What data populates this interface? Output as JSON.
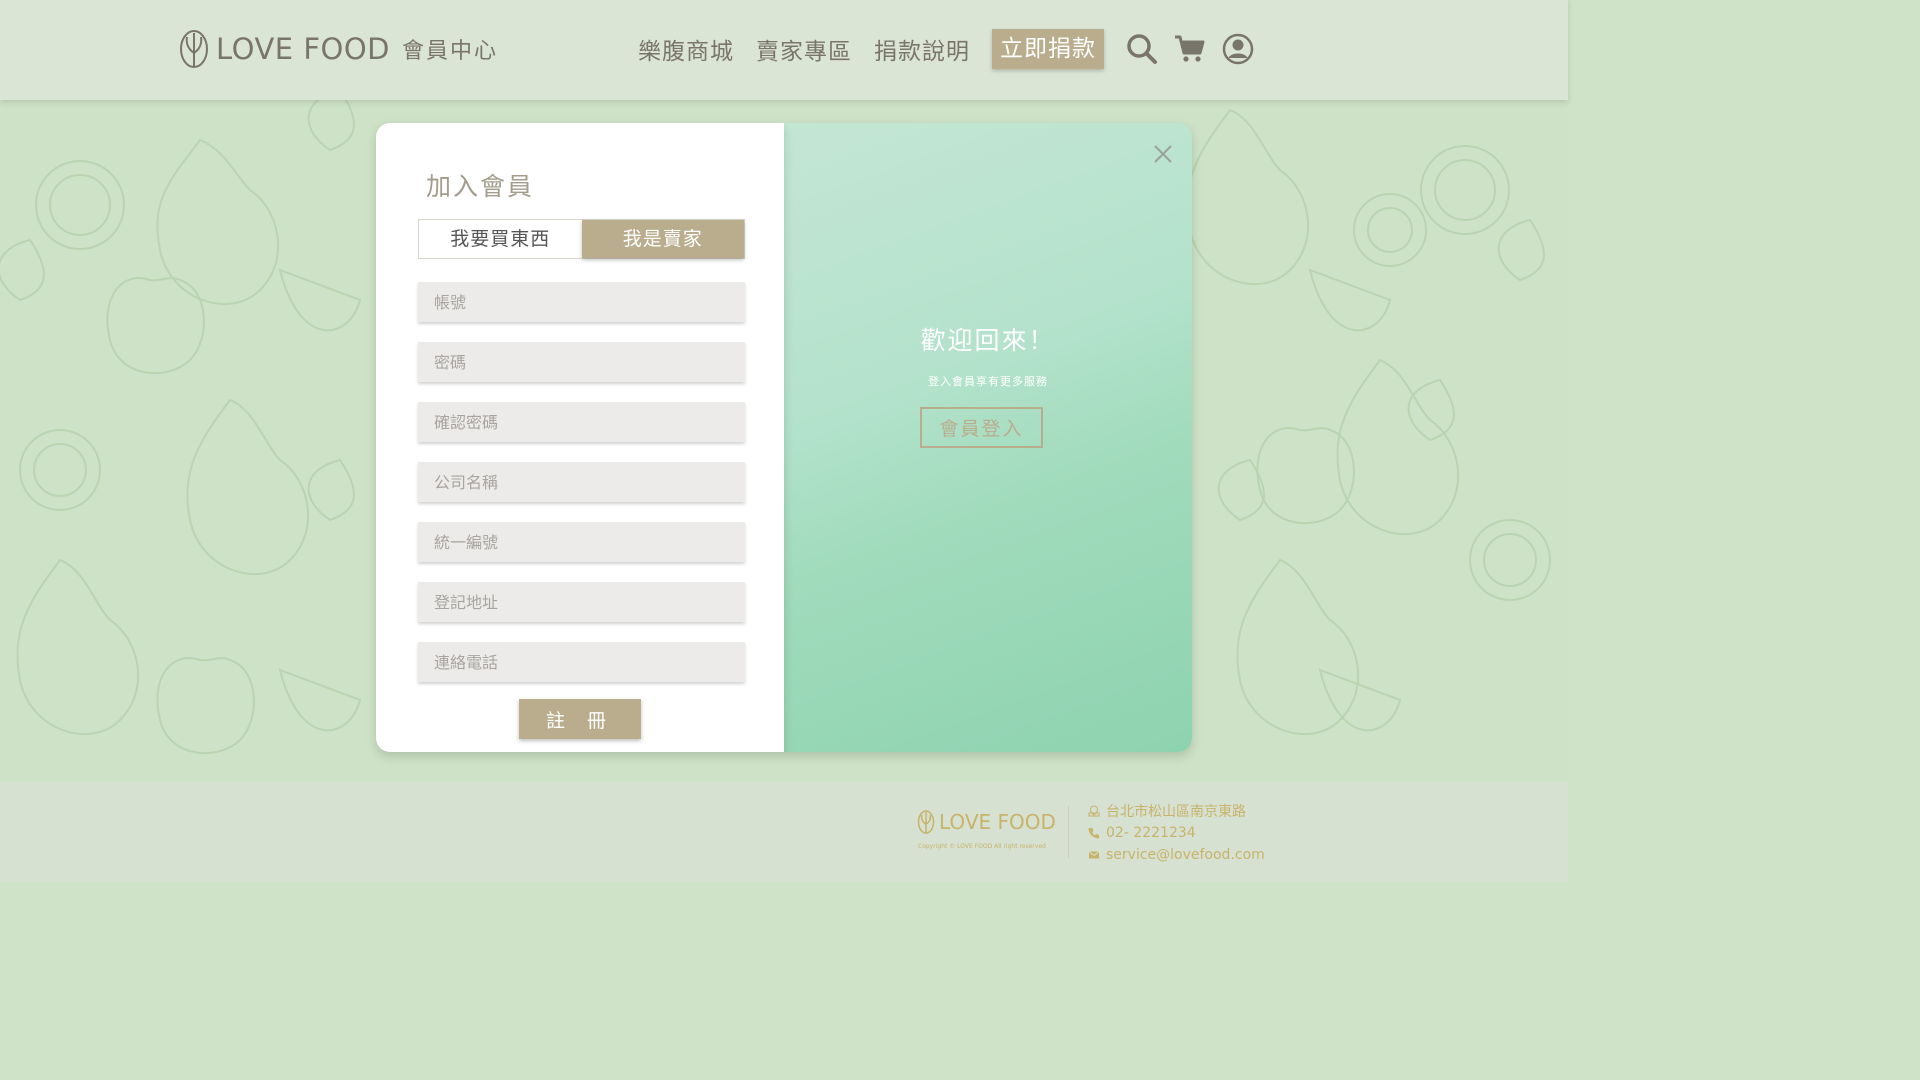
{
  "header": {
    "logo_text": "LOVE FOOD",
    "logo_subtitle": "會員中心",
    "nav": [
      "樂腹商城",
      "賣家專區",
      "捐款說明"
    ],
    "cta": "立即捐款",
    "icons": [
      "search-icon",
      "cart-icon",
      "user-icon"
    ]
  },
  "signup": {
    "title": "加入會員",
    "tabs": {
      "buyer": "我要買東西",
      "seller": "我是賣家",
      "active": "seller"
    },
    "fields": {
      "account": "帳號",
      "password": "密碼",
      "confirm_password": "確認密碼",
      "company_name": "公司名稱",
      "tax_id": "統一編號",
      "address": "登記地址",
      "phone": "連絡電話"
    },
    "submit": "註 冊"
  },
  "welcome": {
    "title": "歡迎回來！",
    "subtitle": "登入會員享有更多服務",
    "login_button": "會員登入"
  },
  "footer": {
    "logo_text": "LOVE FOOD",
    "copyright": "Copyright © LOVE FOOD All right reserved",
    "address": "台北市松山區南京東路",
    "phone": "02- 2221234",
    "email": "service@lovefood.com"
  },
  "colors": {
    "accent": "#b9ad8d",
    "text_dark": "#7a756a",
    "footer_gold": "#c8b36a",
    "background": "#cde2c6",
    "panel_green": "#a0dbbc"
  }
}
